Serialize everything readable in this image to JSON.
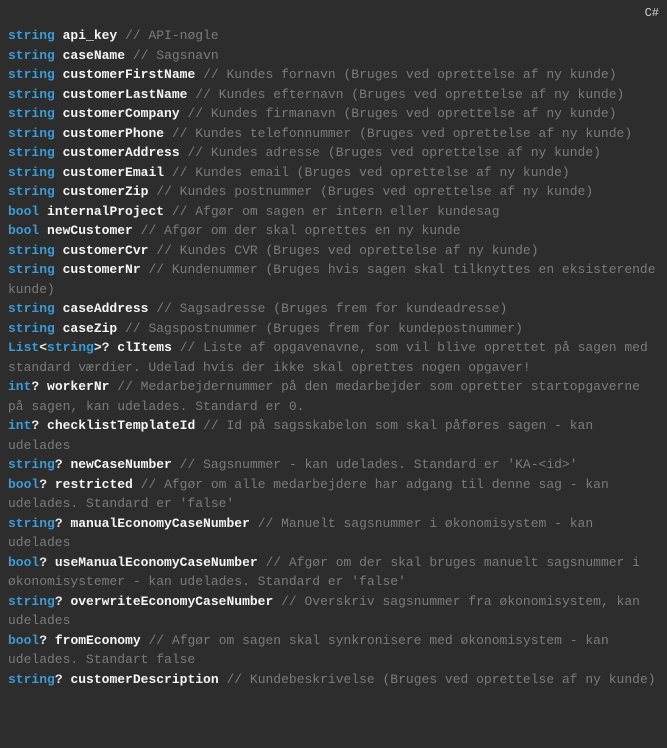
{
  "language_badge": "C#",
  "lines": [
    {
      "type": "string",
      "nullable": "",
      "ident": "api_key",
      "comment": "// API-nøgle"
    },
    {
      "type": "string",
      "nullable": "",
      "ident": "caseName",
      "comment": "// Sagsnavn"
    },
    {
      "type": "string",
      "nullable": "",
      "ident": "customerFirstName",
      "comment": "// Kundes fornavn (Bruges ved oprettelse af ny kunde)"
    },
    {
      "type": "string",
      "nullable": "",
      "ident": "customerLastName",
      "comment": "// Kundes efternavn (Bruges ved oprettelse af ny kunde)"
    },
    {
      "type": "string",
      "nullable": "",
      "ident": "customerCompany",
      "comment": "// Kundes firmanavn (Bruges ved oprettelse af ny kunde)"
    },
    {
      "type": "string",
      "nullable": "",
      "ident": "customerPhone",
      "comment": "// Kundes telefonnummer (Bruges ved oprettelse af ny kunde)"
    },
    {
      "type": "string",
      "nullable": "",
      "ident": "customerAddress",
      "comment": "// Kundes adresse (Bruges ved oprettelse af ny kunde)"
    },
    {
      "type": "string",
      "nullable": "",
      "ident": "customerEmail",
      "comment": "// Kundes email (Bruges ved oprettelse af ny kunde)"
    },
    {
      "type": "string",
      "nullable": "",
      "ident": "customerZip",
      "comment": "// Kundes postnummer (Bruges ved oprettelse af ny kunde)"
    },
    {
      "type": "bool",
      "nullable": "",
      "ident": "internalProject",
      "comment": "// Afgør om sagen er intern eller kundesag"
    },
    {
      "type": "bool",
      "nullable": "",
      "ident": "newCustomer",
      "comment": "// Afgør om der skal oprettes en ny kunde"
    },
    {
      "type": "string",
      "nullable": "",
      "ident": "customerCvr",
      "comment": "// Kundes CVR (Bruges ved oprettelse af ny kunde)"
    },
    {
      "type": "string",
      "nullable": "",
      "ident": "customerNr",
      "comment": "// Kundenummer (Bruges hvis sagen skal tilknyttes en eksisterende kunde)"
    },
    {
      "type": "string",
      "nullable": "",
      "ident": "caseAddress",
      "comment": "// Sagsadresse (Bruges frem for kundeadresse)"
    },
    {
      "type": "string",
      "nullable": "",
      "ident": "caseZip",
      "comment": "// Sagspostnummer (Bruges frem for kundepostnummer)"
    },
    {
      "type": "List<string>",
      "nullable": "?",
      "ident": "clItems",
      "comment": "// Liste af opgavenavne, som vil blive oprettet på sagen med standard værdier. Udelad hvis der ikke skal oprettes nogen opgaver!"
    },
    {
      "type": "int",
      "nullable": "?",
      "ident": "workerNr",
      "comment": "// Medarbejdernummer på den medarbejder som opretter startopgaverne på sagen, kan udelades. Standard er 0."
    },
    {
      "type": "int",
      "nullable": "?",
      "ident": "checklistTemplateId",
      "comment": "// Id på sagsskabelon som skal påføres sagen - kan udelades"
    },
    {
      "type": "string",
      "nullable": "?",
      "ident": "newCaseNumber",
      "comment": "// Sagsnummer - kan udelades. Standard er 'KA-<id>'"
    },
    {
      "type": "bool",
      "nullable": "?",
      "ident": "restricted",
      "comment": "// Afgør om alle medarbejdere har adgang til denne sag - kan udelades. Standard er 'false'"
    },
    {
      "type": "string",
      "nullable": "?",
      "ident": "manualEconomyCaseNumber",
      "comment": "// Manuelt sagsnummer i økonomisystem - kan udelades"
    },
    {
      "type": "bool",
      "nullable": "?",
      "ident": "useManualEconomyCaseNumber",
      "comment": "// Afgør om der skal bruges manuelt sagsnummer i økonomisystemer - kan udelades. Standard er 'false'"
    },
    {
      "type": "string",
      "nullable": "?",
      "ident": "overwriteEconomyCaseNumber",
      "comment": "// Overskriv sagsnummer fra økonomisystem, kan udelades"
    },
    {
      "type": "bool",
      "nullable": "?",
      "ident": "fromEconomy",
      "comment": "// Afgør om sagen skal synkronisere med økonomisystem - kan udelades. Standart false"
    },
    {
      "type": "string",
      "nullable": "?",
      "ident": "customerDescription",
      "comment": "// Kundebeskrivelse (Bruges ved oprettelse af ny kunde)"
    }
  ]
}
